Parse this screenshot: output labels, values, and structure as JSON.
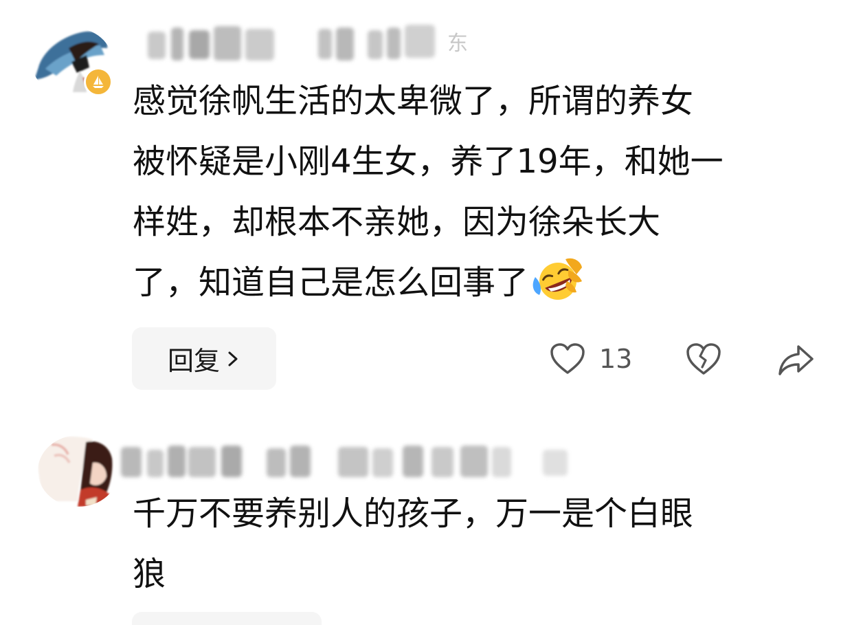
{
  "comments": [
    {
      "username": "东",
      "text_lines": [
        "感觉徐帆生活的太卑微了，所谓的养女",
        "被怀疑是小刚4生女，养了19年，和她一",
        "样姓，却根本不亲她，因为徐朵长大",
        "了，知道自己是怎么回事了"
      ],
      "emoji": "rolling-laughing-emoji",
      "reply_label": "回复",
      "like_count": "13",
      "icons": {
        "like": "heart-icon",
        "dislike": "broken-heart-icon",
        "share": "share-arrow-icon",
        "badge": "sailboat-badge-icon"
      }
    },
    {
      "username": "",
      "text_lines": [
        "千万不要养别人的孩子，万一是个白眼",
        "狼"
      ]
    }
  ],
  "colors": {
    "text": "#111111",
    "muted": "#555555",
    "reply_bg": "#f5f5f5",
    "badge": "#f4b63a",
    "blurred_name": "#c4c4c4"
  }
}
